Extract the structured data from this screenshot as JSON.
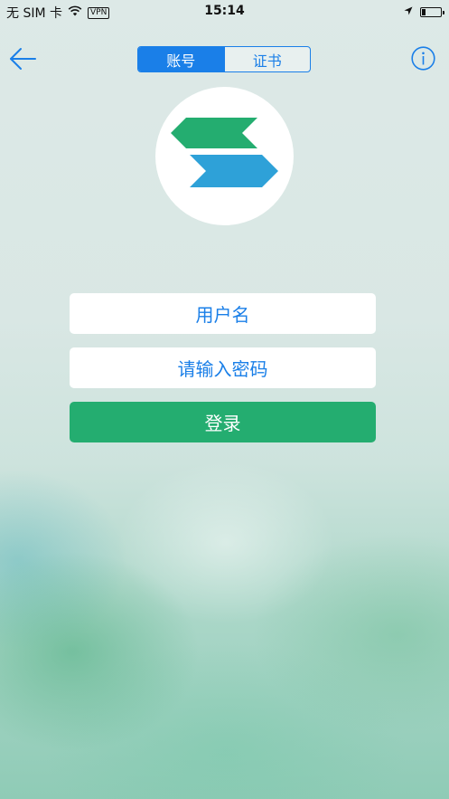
{
  "status_bar": {
    "carrier": "无 SIM 卡",
    "vpn": "VPN",
    "time": "15:14",
    "battery_level": 0.2
  },
  "nav": {
    "segments": [
      {
        "label": "账号",
        "active": true
      },
      {
        "label": "证书",
        "active": false
      }
    ],
    "accent_color": "#1a7fe8"
  },
  "logo": {
    "top_chevron_color": "#24ad70",
    "bottom_chevron_color": "#2ea1d8"
  },
  "form": {
    "username_placeholder": "用户名",
    "password_placeholder": "请输入密码",
    "login_label": "登录",
    "login_color": "#24ad70"
  }
}
